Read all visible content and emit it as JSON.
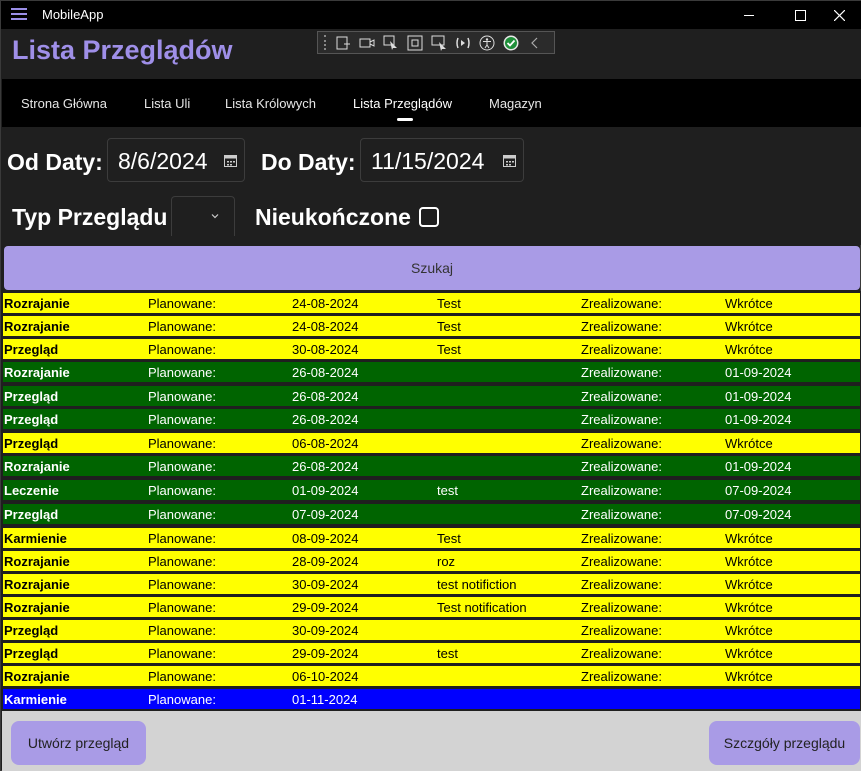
{
  "window": {
    "title": "MobileApp"
  },
  "header": {
    "page_title": "Lista Przeglądów"
  },
  "nav": {
    "items": [
      {
        "label": "Strona Główna"
      },
      {
        "label": "Lista Uli"
      },
      {
        "label": "Lista Królowych"
      },
      {
        "label": "Lista Przeglądów"
      },
      {
        "label": "Magazyn"
      }
    ],
    "active": "Lista Przeglądów"
  },
  "filters": {
    "from_label": "Od Daty:",
    "from_value": "8/6/2024",
    "to_label": "Do Daty:",
    "to_value": "11/15/2024",
    "type_label": "Typ Przeglądu",
    "type_value": "",
    "unfinished_label": "Nieukończone",
    "unfinished_checked": false
  },
  "search_button": "Szukaj",
  "colors": {
    "pending": "#ffff00",
    "done": "#006400",
    "future": "#0000ff",
    "accent": "#a99be6",
    "heading": "#9f8fe8"
  },
  "inspections": [
    {
      "type": "Rozrajanie",
      "planned_label": "Planowane:",
      "planned_date": "24-08-2024",
      "note": "Test",
      "done_label": "Zrealizowane:",
      "done_date": "Wkrótce",
      "status": "yellow"
    },
    {
      "type": "Rozrajanie",
      "planned_label": "Planowane:",
      "planned_date": "24-08-2024",
      "note": "Test",
      "done_label": "Zrealizowane:",
      "done_date": "Wkrótce",
      "status": "yellow"
    },
    {
      "type": "Przegląd",
      "planned_label": "Planowane:",
      "planned_date": "30-08-2024",
      "note": "Test",
      "done_label": "Zrealizowane:",
      "done_date": "Wkrótce",
      "status": "yellow"
    },
    {
      "type": "Rozrajanie",
      "planned_label": "Planowane:",
      "planned_date": "26-08-2024",
      "note": "",
      "done_label": "Zrealizowane:",
      "done_date": "01-09-2024",
      "status": "green"
    },
    {
      "type": "Przegląd",
      "planned_label": "Planowane:",
      "planned_date": "26-08-2024",
      "note": "",
      "done_label": "Zrealizowane:",
      "done_date": "01-09-2024",
      "status": "green"
    },
    {
      "type": "Przegląd",
      "planned_label": "Planowane:",
      "planned_date": "26-08-2024",
      "note": "",
      "done_label": "Zrealizowane:",
      "done_date": "01-09-2024",
      "status": "green"
    },
    {
      "type": "Przegląd",
      "planned_label": "Planowane:",
      "planned_date": "06-08-2024",
      "note": "",
      "done_label": "Zrealizowane:",
      "done_date": "Wkrótce",
      "status": "yellow"
    },
    {
      "type": "Rozrajanie",
      "planned_label": "Planowane:",
      "planned_date": "26-08-2024",
      "note": "",
      "done_label": "Zrealizowane:",
      "done_date": "01-09-2024",
      "status": "green"
    },
    {
      "type": "Leczenie",
      "planned_label": "Planowane:",
      "planned_date": "01-09-2024",
      "note": "test",
      "done_label": "Zrealizowane:",
      "done_date": "07-09-2024",
      "status": "green"
    },
    {
      "type": "Przegląd",
      "planned_label": "Planowane:",
      "planned_date": "07-09-2024",
      "note": "",
      "done_label": "Zrealizowane:",
      "done_date": "07-09-2024",
      "status": "green"
    },
    {
      "type": "Karmienie",
      "planned_label": "Planowane:",
      "planned_date": "08-09-2024",
      "note": "Test",
      "done_label": "Zrealizowane:",
      "done_date": "Wkrótce",
      "status": "yellow"
    },
    {
      "type": "Rozrajanie",
      "planned_label": "Planowane:",
      "planned_date": "28-09-2024",
      "note": "roz",
      "done_label": "Zrealizowane:",
      "done_date": "Wkrótce",
      "status": "yellow"
    },
    {
      "type": "Rozrajanie",
      "planned_label": "Planowane:",
      "planned_date": "30-09-2024",
      "note": "test notifiction",
      "done_label": "Zrealizowane:",
      "done_date": "Wkrótce",
      "status": "yellow"
    },
    {
      "type": "Rozrajanie",
      "planned_label": "Planowane:",
      "planned_date": "29-09-2024",
      "note": "Test notification",
      "done_label": "Zrealizowane:",
      "done_date": "Wkrótce",
      "status": "yellow"
    },
    {
      "type": "Przegląd",
      "planned_label": "Planowane:",
      "planned_date": "30-09-2024",
      "note": "",
      "done_label": "Zrealizowane:",
      "done_date": "Wkrótce",
      "status": "yellow"
    },
    {
      "type": "Przegląd",
      "planned_label": "Planowane:",
      "planned_date": "29-09-2024",
      "note": "test",
      "done_label": "Zrealizowane:",
      "done_date": "Wkrótce",
      "status": "yellow"
    },
    {
      "type": "Rozrajanie",
      "planned_label": "Planowane:",
      "planned_date": "06-10-2024",
      "note": "",
      "done_label": "Zrealizowane:",
      "done_date": "Wkrótce",
      "status": "yellow"
    },
    {
      "type": "Karmienie",
      "planned_label": "Planowane:",
      "planned_date": "01-11-2024",
      "note": "",
      "done_label": "",
      "done_date": "",
      "status": "blue"
    }
  ],
  "footer": {
    "create_button": "Utwórz przegląd",
    "details_button": "Szczgóły przeglądu"
  }
}
